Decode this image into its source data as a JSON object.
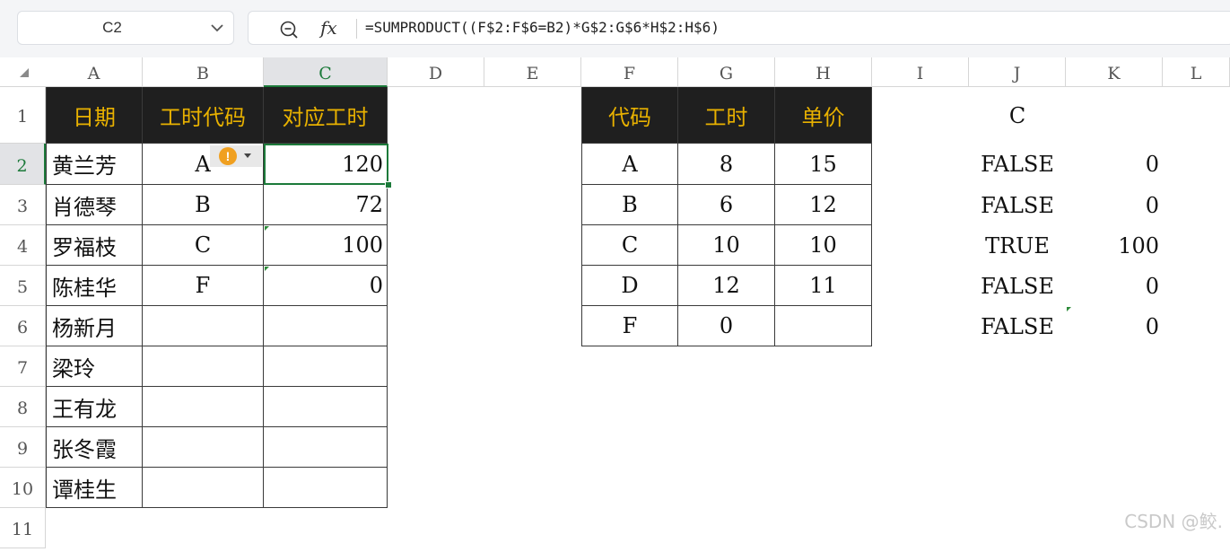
{
  "name_box": {
    "ref": "C2",
    "dropdown_icon": "chevron-down-icon"
  },
  "formula_bar": {
    "zoom_icon": "zoom-out-icon",
    "fx_label": "fx",
    "formula": "=SUMPRODUCT((F$2:F$6=B2)*G$2:G$6*H$2:H$6)"
  },
  "columns": [
    "A",
    "B",
    "C",
    "D",
    "E",
    "F",
    "G",
    "H",
    "I",
    "J",
    "K",
    "L"
  ],
  "rows": [
    "1",
    "2",
    "3",
    "4",
    "5",
    "6",
    "7",
    "8",
    "9",
    "10",
    "11"
  ],
  "selected_cell": "C2",
  "table1": {
    "headers": [
      "日期",
      "工时代码",
      "对应工时"
    ],
    "rows": [
      [
        "黄兰芳",
        "A",
        "120"
      ],
      [
        "肖德琴",
        "B",
        "72"
      ],
      [
        "罗福枝",
        "C",
        "100"
      ],
      [
        "陈桂华",
        "F",
        "0"
      ],
      [
        "杨新月",
        "",
        ""
      ],
      [
        "梁玲",
        "",
        ""
      ],
      [
        "王有龙",
        "",
        ""
      ],
      [
        "张冬霞",
        "",
        ""
      ],
      [
        "谭桂生",
        "",
        ""
      ]
    ]
  },
  "table2": {
    "headers": [
      "代码",
      "工时",
      "单价"
    ],
    "rows": [
      [
        "A",
        "8",
        "15"
      ],
      [
        "B",
        "6",
        "12"
      ],
      [
        "C",
        "10",
        "10"
      ],
      [
        "D",
        "12",
        "11"
      ],
      [
        "F",
        "0",
        ""
      ]
    ]
  },
  "side": {
    "j1": "C",
    "rows": [
      [
        "FALSE",
        "0"
      ],
      [
        "FALSE",
        "0"
      ],
      [
        "TRUE",
        "100"
      ],
      [
        "FALSE",
        "0"
      ],
      [
        "FALSE",
        "0"
      ]
    ]
  },
  "colors": {
    "header_bg": "#1f1f1f",
    "header_text": "#e8b100",
    "select_green": "#1c7a3a",
    "warning": "#f0a020"
  },
  "error_indicator_icon": "warning-icon",
  "watermark": "CSDN @鲛."
}
